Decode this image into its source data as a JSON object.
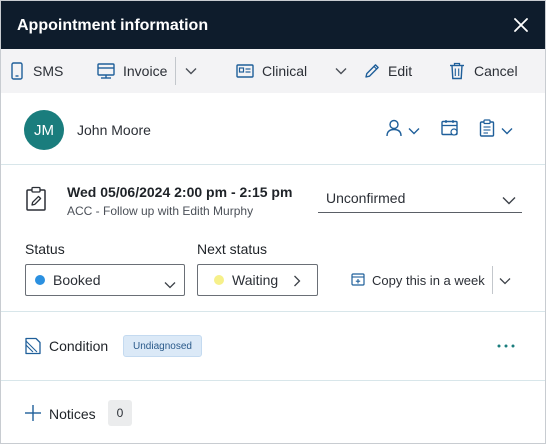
{
  "dialog": {
    "title": "Appointment information",
    "close_icon": "close-icon"
  },
  "toolbar": {
    "sms_label": "SMS",
    "invoice_label": "Invoice",
    "clinical_label": "Clinical",
    "edit_label": "Edit",
    "cancel_label": "Cancel",
    "icons": [
      "phone-icon",
      "invoice-icon",
      "chevron-down-icon",
      "clinical-card-icon",
      "chevron-down-icon",
      "pencil-icon",
      "trash-icon"
    ]
  },
  "patient": {
    "initials": "JM",
    "name": "John Moore",
    "avatar_color": "#1a7d7d",
    "actions": [
      "person-icon",
      "calendar-icon",
      "clipboard-icon"
    ]
  },
  "appointment": {
    "datetime": "Wed 05/06/2024 2:00 pm - 2:15 pm",
    "description": "ACC - Follow up with Edith Murphy",
    "confirmation": "Unconfirmed",
    "status_label": "Status",
    "status_value": "Booked",
    "status_color": "#2b90e0",
    "next_status_label": "Next status",
    "next_status_value": "Waiting",
    "next_status_color": "#f6f08a",
    "copy_label": "Copy this in a week"
  },
  "condition": {
    "label": "Condition",
    "badge": "Undiagnosed"
  },
  "notices": {
    "label": "Notices",
    "count": "0"
  },
  "colors": {
    "titlebar": "#0e1c2c",
    "accent": "#1a7d7d",
    "link": "#2f6fa8"
  }
}
